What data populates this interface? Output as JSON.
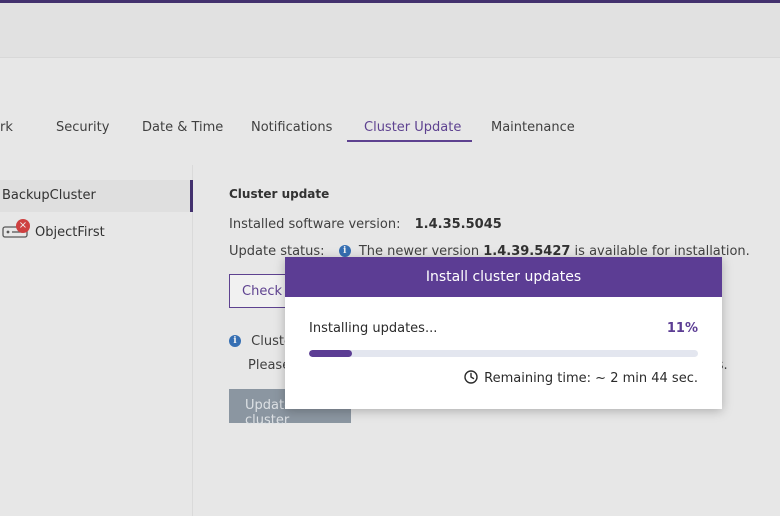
{
  "tabs": [
    {
      "label": "rk"
    },
    {
      "label": "Security"
    },
    {
      "label": "Date & Time"
    },
    {
      "label": "Notifications"
    },
    {
      "label": "Cluster Update",
      "active": true
    },
    {
      "label": "Maintenance"
    }
  ],
  "sidebar": {
    "cluster": {
      "label": "BackupCluster"
    },
    "node": {
      "label": "ObjectFirst",
      "icon": "server-icon",
      "badge": "×"
    }
  },
  "content": {
    "title": "Cluster update",
    "installed_label": "Installed software version:",
    "installed_value": "1.4.35.5045",
    "status_label": "Update status:",
    "status_text_pre": "The newer version ",
    "status_version": "1.4.39.5427",
    "status_text_post": " is available for installation.",
    "check_button_label": "Check",
    "notice_line1": "Cluste",
    "notice_line2": "Please",
    "notice_line2_tail": "ss.",
    "update_button_label": "Update cluster"
  },
  "modal": {
    "title": "Install cluster updates",
    "status_text": "Installing updates...",
    "percent_text": "11%",
    "progress_fraction": 0.11,
    "remaining_text": "Remaining time: ~ 2 min 44 sec."
  },
  "colors": {
    "accent": "#5c3d94",
    "info": "#2f6fba",
    "error": "#d83a3a"
  }
}
